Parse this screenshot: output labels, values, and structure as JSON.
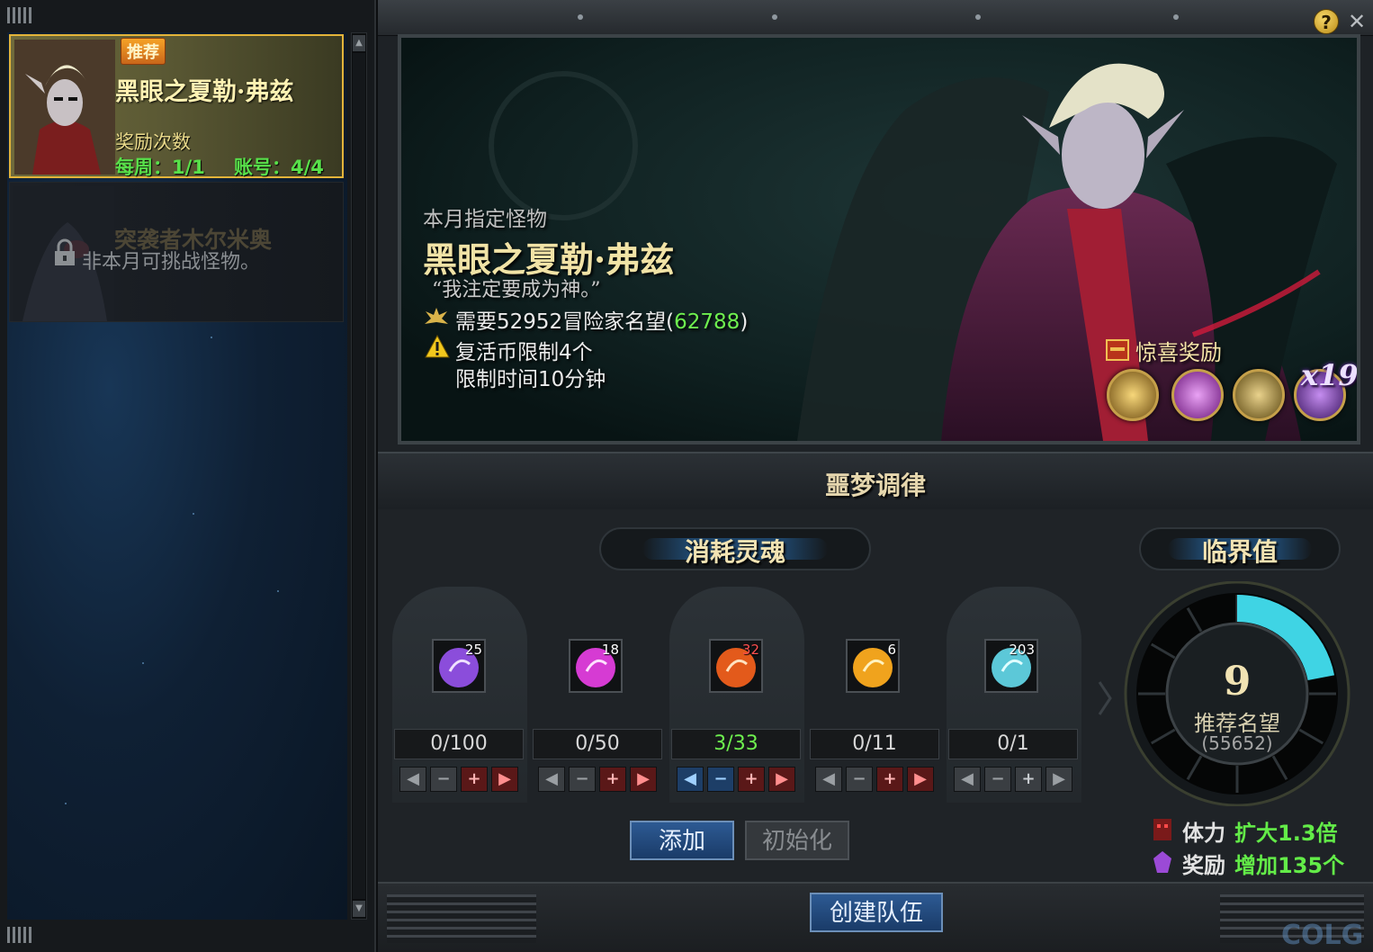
{
  "left": {
    "cards": [
      {
        "badge": "推荐",
        "name": "黑眼之夏勒·弗兹",
        "reward_label": "奖励次数",
        "weekly": "每周：1/1",
        "account": "账号：4/4"
      },
      {
        "name": "突袭者木尔米奥",
        "lock_note": "非本月可挑战怪物。"
      }
    ]
  },
  "window": {
    "help": "?",
    "close": "✕"
  },
  "banner": {
    "subtitle": "本月指定怪物",
    "name": "黑眼之夏勒·弗兹",
    "quote": "“我注定要成为神。”",
    "requirement_prefix": "需要52952冒险家名望(",
    "requirement_value": "62788",
    "requirement_suffix": ")",
    "revive_limit": "复活币限制4个",
    "time_limit": "限制时间10分钟",
    "surprise_label": "惊喜奖励",
    "multiplier": "x19",
    "reward_icons": [
      "gold-gem-icon",
      "purple-gem-icon",
      "gold-bundle-icon",
      "purple-emblem-icon"
    ]
  },
  "section": {
    "title": "噩梦调律",
    "consume_label": "消耗灵魂",
    "critical_label": "临界值"
  },
  "souls": [
    {
      "count": "25",
      "qty": "0/100",
      "color": "#8b4ddb"
    },
    {
      "count": "18",
      "qty": "0/50",
      "color": "#d63bd3"
    },
    {
      "count": "32",
      "qty": "3/33",
      "color": "#e35a1b"
    },
    {
      "count": "6",
      "qty": "0/11",
      "color": "#f0a31d"
    },
    {
      "count": "203",
      "qty": "0/1",
      "color": "#5cc8d8"
    }
  ],
  "buttons": {
    "add": "添加",
    "reset": "初始化",
    "create_team": "创建队伍"
  },
  "gauge": {
    "value": "9",
    "label": "推荐名望",
    "sub": "(55652)",
    "fill_fraction": 0.22
  },
  "effects": [
    {
      "label": "体力",
      "value": "扩大1.3倍"
    },
    {
      "label": "奖励",
      "value": "增加135个"
    }
  ],
  "watermark": "COLG"
}
